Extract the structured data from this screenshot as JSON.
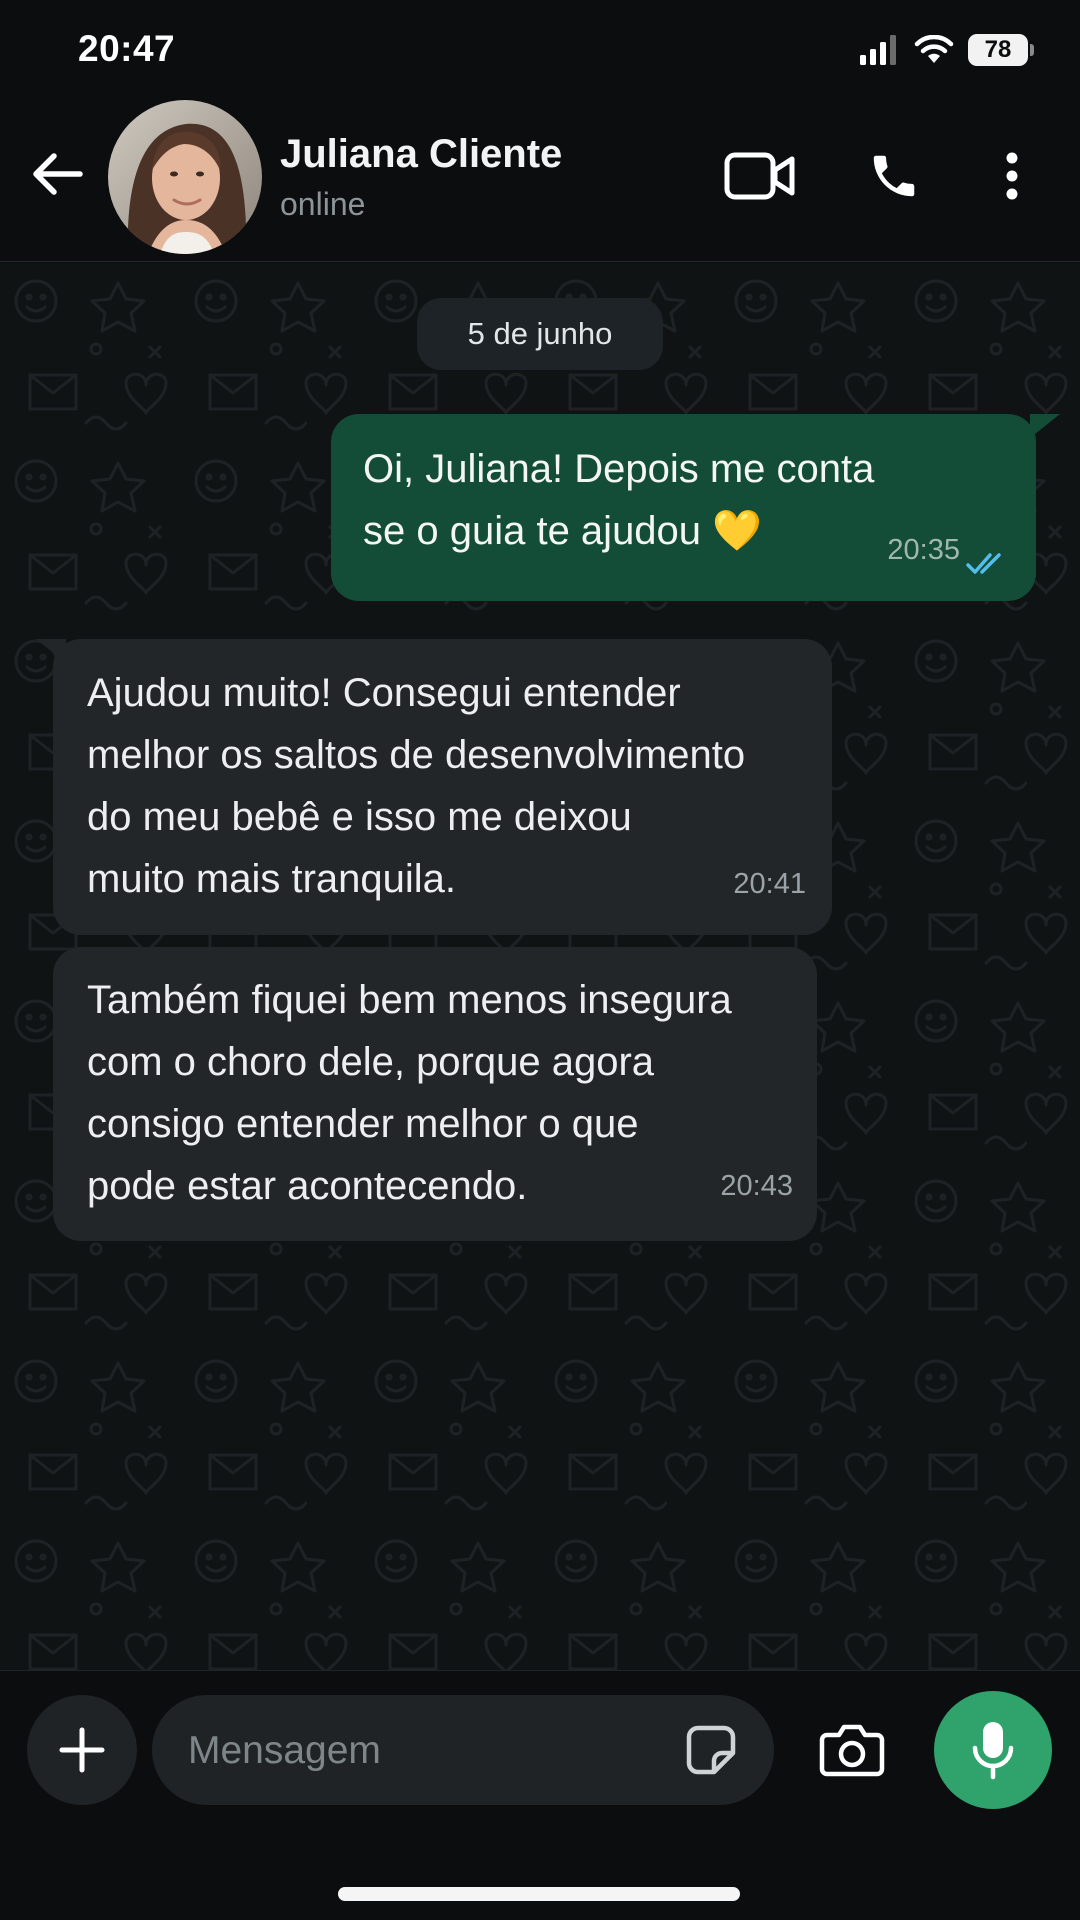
{
  "status_bar": {
    "time": "20:47",
    "battery": "78",
    "icons": [
      "signal-icon",
      "wifi-icon",
      "battery-icon"
    ]
  },
  "header": {
    "contact_name": "Juliana Cliente",
    "contact_status": "online",
    "icons": [
      "back-arrow-icon",
      "video-call-icon",
      "phone-icon",
      "more-options-icon"
    ]
  },
  "chat": {
    "date_separator": "5 de junho",
    "messages": [
      {
        "direction": "outgoing",
        "text": "Oi, Juliana! Depois me conta\nse o guia te ajudou 💛",
        "time": "20:35",
        "status": "read"
      },
      {
        "direction": "incoming",
        "text": "Ajudou muito! Consegui entender\nmelhor os saltos de desenvolvimento\ndo meu bebê e isso me deixou\nmuito mais tranquila.",
        "time": "20:41"
      },
      {
        "direction": "incoming",
        "text": "Também fiquei bem menos insegura\ncom o choro dele, porque agora\nconsigo entender melhor o que\npode estar acontecendo.",
        "time": "20:43"
      }
    ]
  },
  "input_bar": {
    "placeholder": "Mensagem",
    "icons": [
      "plus-icon",
      "sticker-icon",
      "camera-icon",
      "microphone-icon"
    ]
  },
  "colors": {
    "outgoing_bubble": "#144d37",
    "incoming_bubble": "#232628",
    "read_check": "#53bdeb",
    "mic_button": "#2fa36b"
  }
}
